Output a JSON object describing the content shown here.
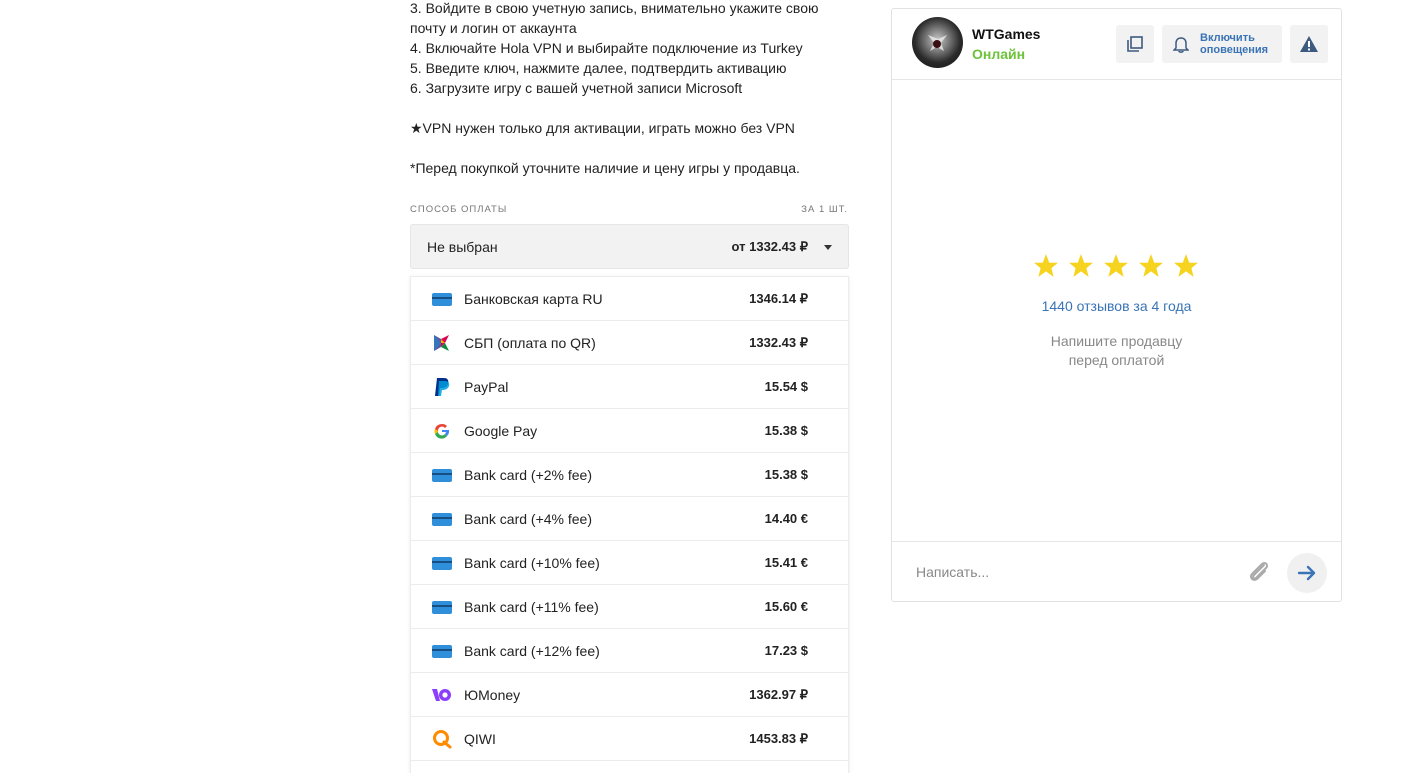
{
  "description": {
    "lines": [
      "3. Войдите в свою учетную запись, внимательно укажите свою",
      "почту и логин от аккаунта",
      "4. Включайте Hola VPN и выбирайте подключение из Turkey",
      "5. Введите ключ, нажмите далее, подтвердить активацию",
      "6. Загрузите игру с вашей учетной записи Microsoft",
      "★VPN нужен только для активации, играть можно без VPN",
      "*Перед покупкой уточните наличие и цену игры у продавца."
    ]
  },
  "payment": {
    "label": "СПОСОБ ОПЛАТЫ",
    "per_unit": "ЗА 1 ШТ.",
    "selected": "Не выбран",
    "from_price": "от 1332.43 ₽",
    "methods": [
      {
        "name": "Банковская карта RU",
        "price": "1346.14 ₽",
        "icon": "bank-card-icon"
      },
      {
        "name": "СБП (оплата по QR)",
        "price": "1332.43 ₽",
        "icon": "sbp-icon"
      },
      {
        "name": "PayPal",
        "price": "15.54 $",
        "icon": "paypal-icon"
      },
      {
        "name": "Google Pay",
        "price": "15.38 $",
        "icon": "google-icon"
      },
      {
        "name": "Bank card (+2% fee)",
        "price": "15.38 $",
        "icon": "bank-card-icon"
      },
      {
        "name": "Bank card (+4% fee)",
        "price": "14.40 €",
        "icon": "bank-card-icon"
      },
      {
        "name": "Bank card (+10% fee)",
        "price": "15.41 €",
        "icon": "bank-card-icon"
      },
      {
        "name": "Bank card (+11% fee)",
        "price": "15.60 €",
        "icon": "bank-card-icon"
      },
      {
        "name": "Bank card (+12% fee)",
        "price": "17.23 $",
        "icon": "bank-card-icon"
      },
      {
        "name": "ЮMoney",
        "price": "1362.97 ₽",
        "icon": "yoomoney-icon"
      },
      {
        "name": "QIWI",
        "price": "1453.83 ₽",
        "icon": "qiwi-icon"
      }
    ]
  },
  "seller": {
    "name": "WTGames",
    "status": "Онлайн",
    "notify_line1": "Включить",
    "notify_line2": "оповещения",
    "rating_stars": 5,
    "reviews": "1440 отзывов за 4 года",
    "hint_line1": "Напишите продавцу",
    "hint_line2": "перед оплатой",
    "message_placeholder": "Написать..."
  },
  "colors": {
    "accent_blue": "#3a74b6",
    "online_green": "#6cc23a",
    "star_yellow": "#f5d31f"
  }
}
